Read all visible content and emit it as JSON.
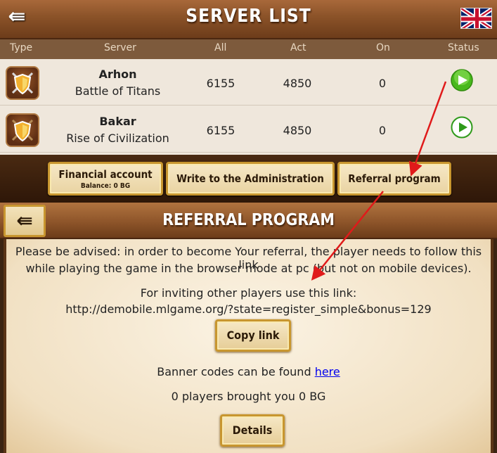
{
  "header": {
    "back_glyph": "⇚",
    "title": "SERVER LIST",
    "flag_icon": "uk-flag-icon"
  },
  "table": {
    "columns": [
      "Type",
      "Server",
      "All",
      "Act",
      "On",
      "Status"
    ],
    "rows": [
      {
        "name": "Arhon",
        "subtitle": "Battle of Titans",
        "all": "6155",
        "act": "4850",
        "on": "0",
        "status_icon": "play-green-filled-icon"
      },
      {
        "name": "Bakar",
        "subtitle": "Rise of Civilization",
        "all": "6155",
        "act": "4850",
        "on": "0",
        "status_icon": "play-green-outline-icon"
      }
    ]
  },
  "actions": {
    "financial_label": "Financial account",
    "balance_label": "Balance: 0 BG",
    "write_admin_label": "Write to the Administration",
    "referral_label": "Referral program"
  },
  "referral": {
    "back_glyph": "⇚",
    "title": "REFERRAL PROGRAM",
    "notice_line1": "Please be advised: in order to become Your referral, the player needs to follow this link",
    "notice_line2": "while playing the game in the browser mode at pc (but not on mobile devices).",
    "invite_label": "For inviting other players use this link:",
    "invite_link": "http://demobile.mlgame.org/?state=register_simple&bonus=129",
    "copy_label": "Copy link",
    "banner_prefix": "Banner codes can be found ",
    "banner_link": "here",
    "brought_text": "0 players brought you 0 BG",
    "details_label": "Details"
  },
  "colors": {
    "wood_header": "#8a5228",
    "table_bg": "#efe7dc",
    "gold_border": "#c8962f",
    "status_green": "#3cae16",
    "annotation_red": "#e01a1a"
  }
}
